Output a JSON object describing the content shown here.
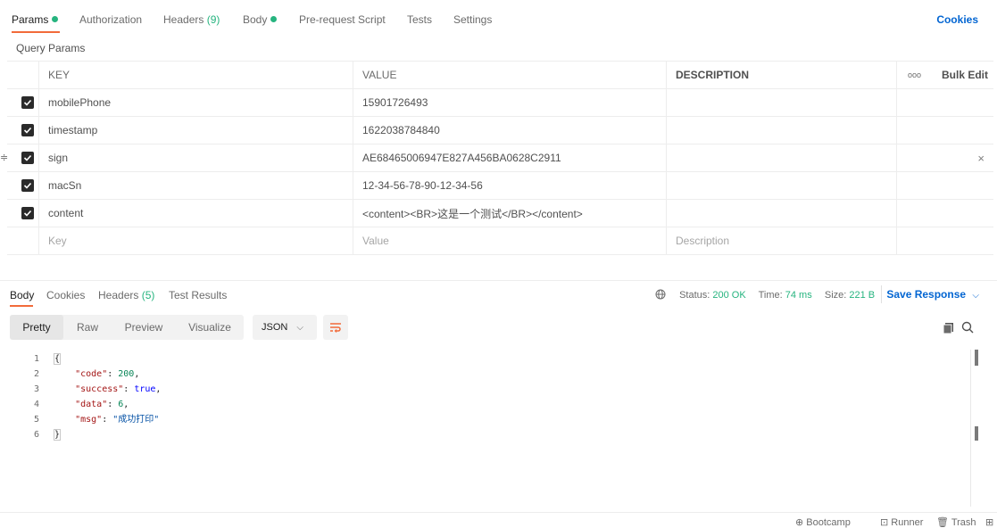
{
  "request_tabs": [
    {
      "label": "Params",
      "dot": true,
      "active": true
    },
    {
      "label": "Authorization"
    },
    {
      "label": "Headers",
      "count": "(9)"
    },
    {
      "label": "Body",
      "dot": true
    },
    {
      "label": "Pre-request Script"
    },
    {
      "label": "Tests"
    },
    {
      "label": "Settings"
    }
  ],
  "cookies_label": "Cookies",
  "section_label": "Query Params",
  "params_table": {
    "headers": {
      "key": "KEY",
      "value": "VALUE",
      "description": "DESCRIPTION",
      "more": "ooo",
      "bulk_edit": "Bulk Edit"
    },
    "rows": [
      {
        "key": "mobilePhone",
        "value": "15901726493",
        "checked": true
      },
      {
        "key": "timestamp",
        "value": "1622038784840",
        "checked": true
      },
      {
        "key": "sign",
        "value": "AE68465006947E827A456BA0628C2911",
        "checked": true
      },
      {
        "key": "macSn",
        "value": "12-34-56-78-90-12-34-56",
        "checked": true
      },
      {
        "key": "content",
        "value": "<content><BR>这是一个测试</BR></content>",
        "checked": true
      }
    ],
    "placeholder": {
      "key": "Key",
      "value": "Value",
      "description": "Description"
    }
  },
  "response_tabs": [
    {
      "label": "Body",
      "active": true
    },
    {
      "label": "Cookies"
    },
    {
      "label": "Headers",
      "count": "(5)"
    },
    {
      "label": "Test Results"
    }
  ],
  "status": {
    "status_label": "Status:",
    "status_value": "200 OK",
    "time_label": "Time:",
    "time_value": "74 ms",
    "size_label": "Size:",
    "size_value": "221 B"
  },
  "save_response": "Save Response",
  "view_modes": [
    "Pretty",
    "Raw",
    "Preview",
    "Visualize"
  ],
  "format": "JSON",
  "code_lines": [
    "1",
    "2",
    "3",
    "4",
    "5",
    "6"
  ],
  "json_body": {
    "code_key": "\"code\"",
    "code_val": "200",
    "success_key": "\"success\"",
    "success_val": "true",
    "data_key": "\"data\"",
    "data_val": "6",
    "msg_key": "\"msg\"",
    "msg_val": "\"成功打印\""
  },
  "footer": {
    "bootcamp": "Bootcamp",
    "runner": "Runner",
    "trash": "Trash"
  },
  "colors": {
    "accent": "#f26b3a",
    "link": "#0265d2",
    "success": "#26b47f"
  }
}
